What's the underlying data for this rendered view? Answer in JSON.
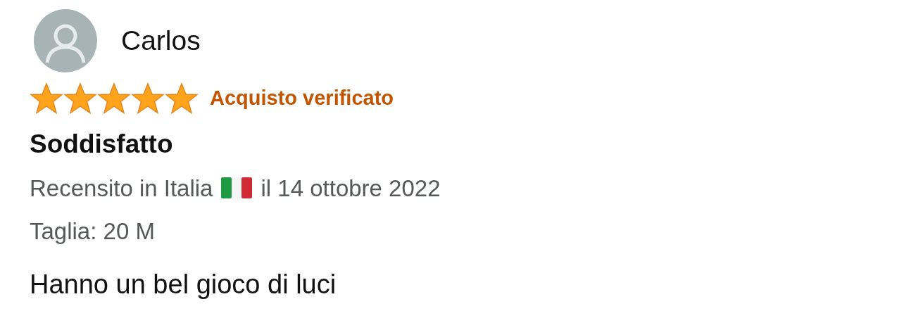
{
  "review": {
    "author": "Carlos",
    "stars": 5,
    "badge": "Acquisto verificato",
    "title": "Soddisfatto",
    "reviewed_in": "Recensito in Italia",
    "date": "il 14 ottobre 2022",
    "variant": "Taglia: 20 M",
    "body": "Hanno un bel gioco di luci"
  }
}
